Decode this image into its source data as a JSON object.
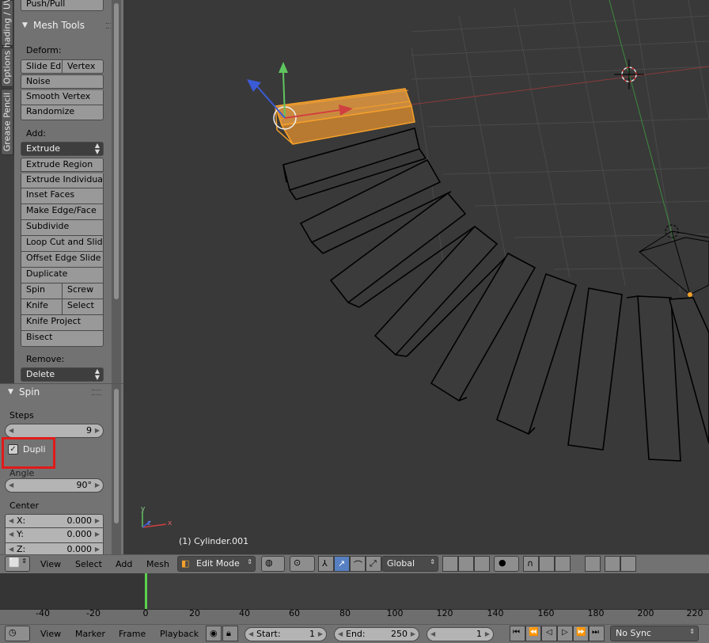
{
  "side_tabs": [
    "Shading / UVs",
    "Options",
    "Grease Pencil"
  ],
  "tool_shelf": {
    "top_button": "Push/Pull",
    "panel_title": "Mesh Tools",
    "deform_label": "Deform:",
    "deform_buttons": {
      "slide_edge": "Slide Ed",
      "vertex": "Vertex",
      "noise": "Noise",
      "smooth_vertex": "Smooth Vertex",
      "randomize": "Randomize"
    },
    "add_label": "Add:",
    "extrude_dropdown": "Extrude",
    "add_buttons": {
      "extrude_region": "Extrude Region",
      "extrude_individual": "Extrude Individual",
      "inset_faces": "Inset Faces",
      "make_edge_face": "Make Edge/Face",
      "subdivide": "Subdivide",
      "loop_cut_slide": "Loop Cut and Slide",
      "offset_edge_slide": "Offset Edge Slide",
      "duplicate": "Duplicate",
      "spin": "Spin",
      "screw": "Screw",
      "knife": "Knife",
      "select": "Select",
      "knife_project": "Knife Project",
      "bisect": "Bisect"
    },
    "remove_label": "Remove:",
    "delete_dropdown": "Delete"
  },
  "operator_panel": {
    "title": "Spin",
    "steps_label": "Steps",
    "steps_value": "9",
    "dupli_label": "Dupli",
    "dupli_checked": true,
    "angle_label": "Angle",
    "angle_value": "90°",
    "center_label": "Center",
    "center": [
      {
        "axis": "X:",
        "value": "0.000"
      },
      {
        "axis": "Y:",
        "value": "0.000"
      },
      {
        "axis": "Z:",
        "value": "0.000"
      }
    ]
  },
  "viewport": {
    "object_label": "(1) Cylinder.001",
    "axis_x": "x",
    "axis_y": "y",
    "axis_z": "z"
  },
  "header": {
    "view": "View",
    "select": "Select",
    "add": "Add",
    "mesh": "Mesh",
    "mode": "Edit Mode",
    "orientation": "Global"
  },
  "timeline": {
    "ticks": [
      "-40",
      "-20",
      "0",
      "20",
      "40",
      "60",
      "80",
      "100",
      "120",
      "140",
      "160",
      "180",
      "200",
      "220"
    ],
    "current_frame_marker": "0"
  },
  "timeline_header": {
    "view": "View",
    "marker": "Marker",
    "frame": "Frame",
    "playback": "Playback",
    "start_label": "Start:",
    "start_value": "1",
    "end_label": "End:",
    "end_value": "250",
    "current_frame": "1",
    "sync": "No Sync"
  },
  "colors": {
    "selection_orange": "#f5a02a",
    "highlight_red": "#e01a1a",
    "x_axis": "#d04040",
    "y_axis": "#5fc45f",
    "z_axis": "#3b5bd6",
    "frame_cursor": "#5bd14b"
  }
}
